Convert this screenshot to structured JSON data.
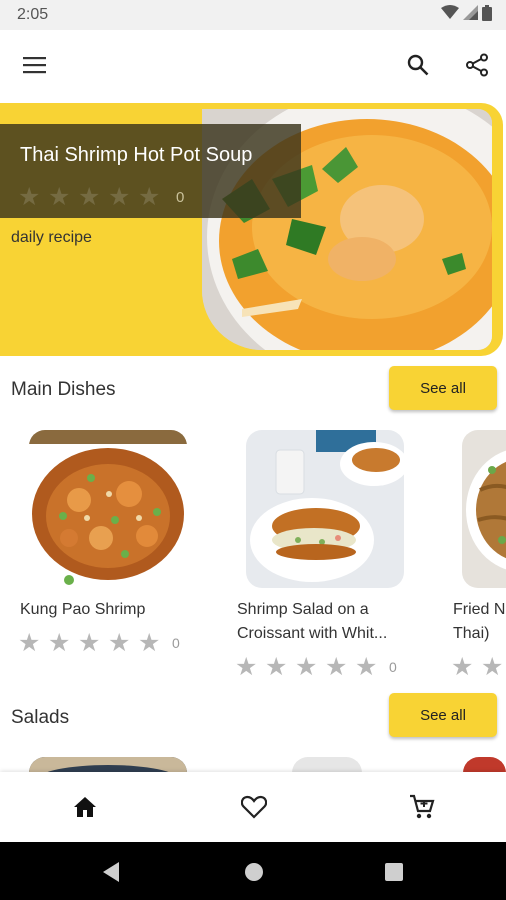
{
  "status_bar": {
    "time": "2:05",
    "icons": [
      "wifi-icon",
      "signal-icon",
      "battery-icon"
    ]
  },
  "app_bar": {
    "icons": [
      "menu-icon",
      "search-icon",
      "share-icon"
    ]
  },
  "hero": {
    "title": "Thai Shrimp Hot Pot Soup",
    "rating_count": "0",
    "rating": 0,
    "caption": "daily recipe"
  },
  "sections": [
    {
      "title": "Main Dishes",
      "see_all_label": "See all",
      "cards": [
        {
          "name": "Kung Pao Shrimp",
          "rating": 0,
          "rating_count": "0"
        },
        {
          "name": "Shrimp Salad on a Croissant with Whit...",
          "rating": 0,
          "rating_count": "0"
        },
        {
          "name": "Fried N\nThai)",
          "rating": 0,
          "rating_count": ""
        }
      ]
    },
    {
      "title": "Salads",
      "see_all_label": "See all"
    }
  ],
  "bottom_nav": {
    "items": [
      "home-icon",
      "heart-icon",
      "cart-icon"
    ],
    "active": "home-icon"
  },
  "system_nav": {
    "items": [
      "back-icon",
      "home-circle-icon",
      "recents-icon"
    ]
  },
  "colors": {
    "accent": "#f8d334",
    "star_inactive": "#b7b7b7",
    "overlay": "#3a341c"
  }
}
